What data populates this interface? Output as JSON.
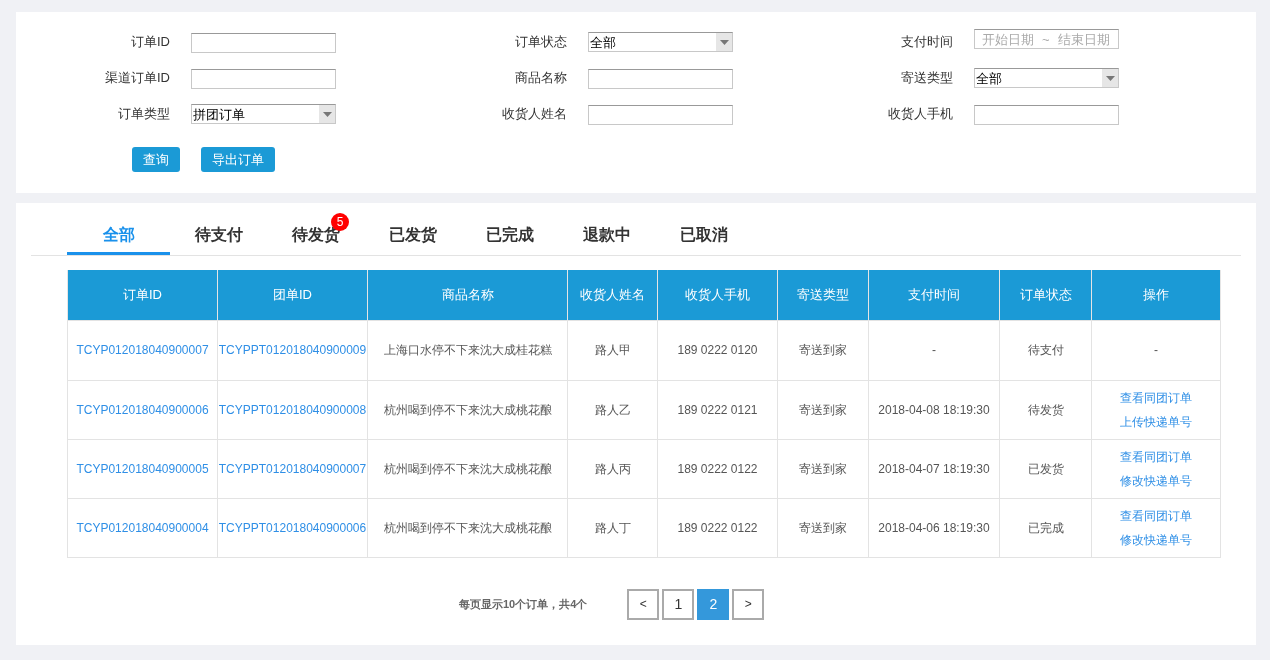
{
  "filters": [
    {
      "label": "订单ID",
      "kind": "text"
    },
    {
      "label": "订单状态",
      "kind": "select",
      "value": "全部"
    },
    {
      "label": "支付时间",
      "kind": "date_range",
      "start_placeholder": "开始日期",
      "separator": "~",
      "end_placeholder": "结束日期"
    },
    {
      "label": "渠道订单ID",
      "kind": "text"
    },
    {
      "label": "商品名称",
      "kind": "text"
    },
    {
      "label": "寄送类型",
      "kind": "select",
      "value": "全部"
    },
    {
      "label": "订单类型",
      "kind": "select",
      "value": "拼团订单"
    },
    {
      "label": "收货人姓名",
      "kind": "text"
    },
    {
      "label": "收货人手机",
      "kind": "text"
    }
  ],
  "buttons": [
    "查询",
    "导出订单"
  ],
  "tabs": [
    {
      "label": "全部",
      "selected": true
    },
    {
      "label": "待支付",
      "selected": false
    },
    {
      "label": "待发货",
      "selected": false,
      "badge": "5"
    },
    {
      "label": "已发货",
      "selected": false
    },
    {
      "label": "已完成",
      "selected": false
    },
    {
      "label": "退款中",
      "selected": false
    },
    {
      "label": "已取消",
      "selected": false
    }
  ],
  "table": {
    "columns": [
      "订单ID",
      "团单ID",
      "商品名称",
      "收货人姓名",
      "收货人手机",
      "寄送类型",
      "支付时间",
      "订单状态",
      "操作"
    ],
    "rows": [
      {
        "order_id": "TCYP012018040900007",
        "group_id": "TCYPPT012018040900009",
        "product": "上海口水停不下来沈大成桂花糕",
        "name": "路人甲",
        "phone": "189 0222 0120",
        "delivery": "寄送到家",
        "paid_at": "-",
        "status": "待支付",
        "actions": [
          "-"
        ]
      },
      {
        "order_id": "TCYP012018040900006",
        "group_id": "TCYPPT012018040900008",
        "product": "杭州喝到停不下来沈大成桃花酿",
        "name": "路人乙",
        "phone": "189 0222 0121",
        "delivery": "寄送到家",
        "paid_at": "2018-04-08 18:19:30",
        "status": "待发货",
        "actions": [
          "查看同团订单",
          "上传快递单号"
        ]
      },
      {
        "order_id": "TCYP012018040900005",
        "group_id": "TCYPPT012018040900007",
        "product": "杭州喝到停不下来沈大成桃花酿",
        "name": "路人丙",
        "phone": "189 0222 0122",
        "delivery": "寄送到家",
        "paid_at": "2018-04-07 18:19:30",
        "status": "已发货",
        "actions": [
          "查看同团订单",
          "修改快递单号"
        ]
      },
      {
        "order_id": "TCYP012018040900004",
        "group_id": "TCYPPT012018040900006",
        "product": "杭州喝到停不下来沈大成桃花酿",
        "name": "路人丁",
        "phone": "189 0222 0122",
        "delivery": "寄送到家",
        "paid_at": "2018-04-06 18:19:30",
        "status": "已完成",
        "actions": [
          "查看同团订单",
          "修改快递单号"
        ]
      }
    ]
  },
  "pagination": {
    "summary": "每页显示10个订单，共4个",
    "prev": "<",
    "pages": [
      {
        "label": "1",
        "selected": false
      },
      {
        "label": "2",
        "selected": true
      }
    ],
    "next": ">"
  }
}
